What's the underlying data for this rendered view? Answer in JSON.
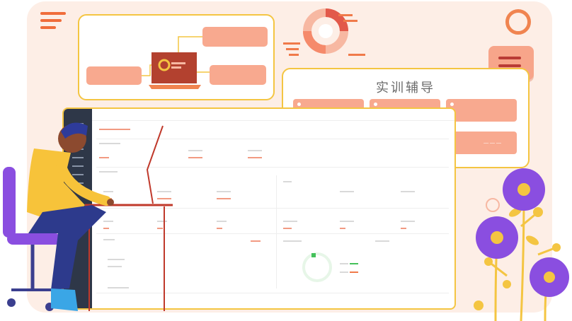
{
  "tutor_panel": {
    "title": "实训辅导",
    "last_tile_text": "— — —"
  },
  "colors": {
    "background_card": "#fdeee6",
    "accent_orange": "#f06d3b",
    "tile_salmon": "#f8a98f",
    "panel_border": "#f4c542",
    "sidebar_dark": "#2e3748",
    "flower_purple": "#8a4ee0",
    "flower_yellow": "#f4c542"
  },
  "icons": [
    "menu-icon",
    "ring-icon",
    "chat-icon",
    "donut-chart-icon",
    "laptop-icon"
  ]
}
